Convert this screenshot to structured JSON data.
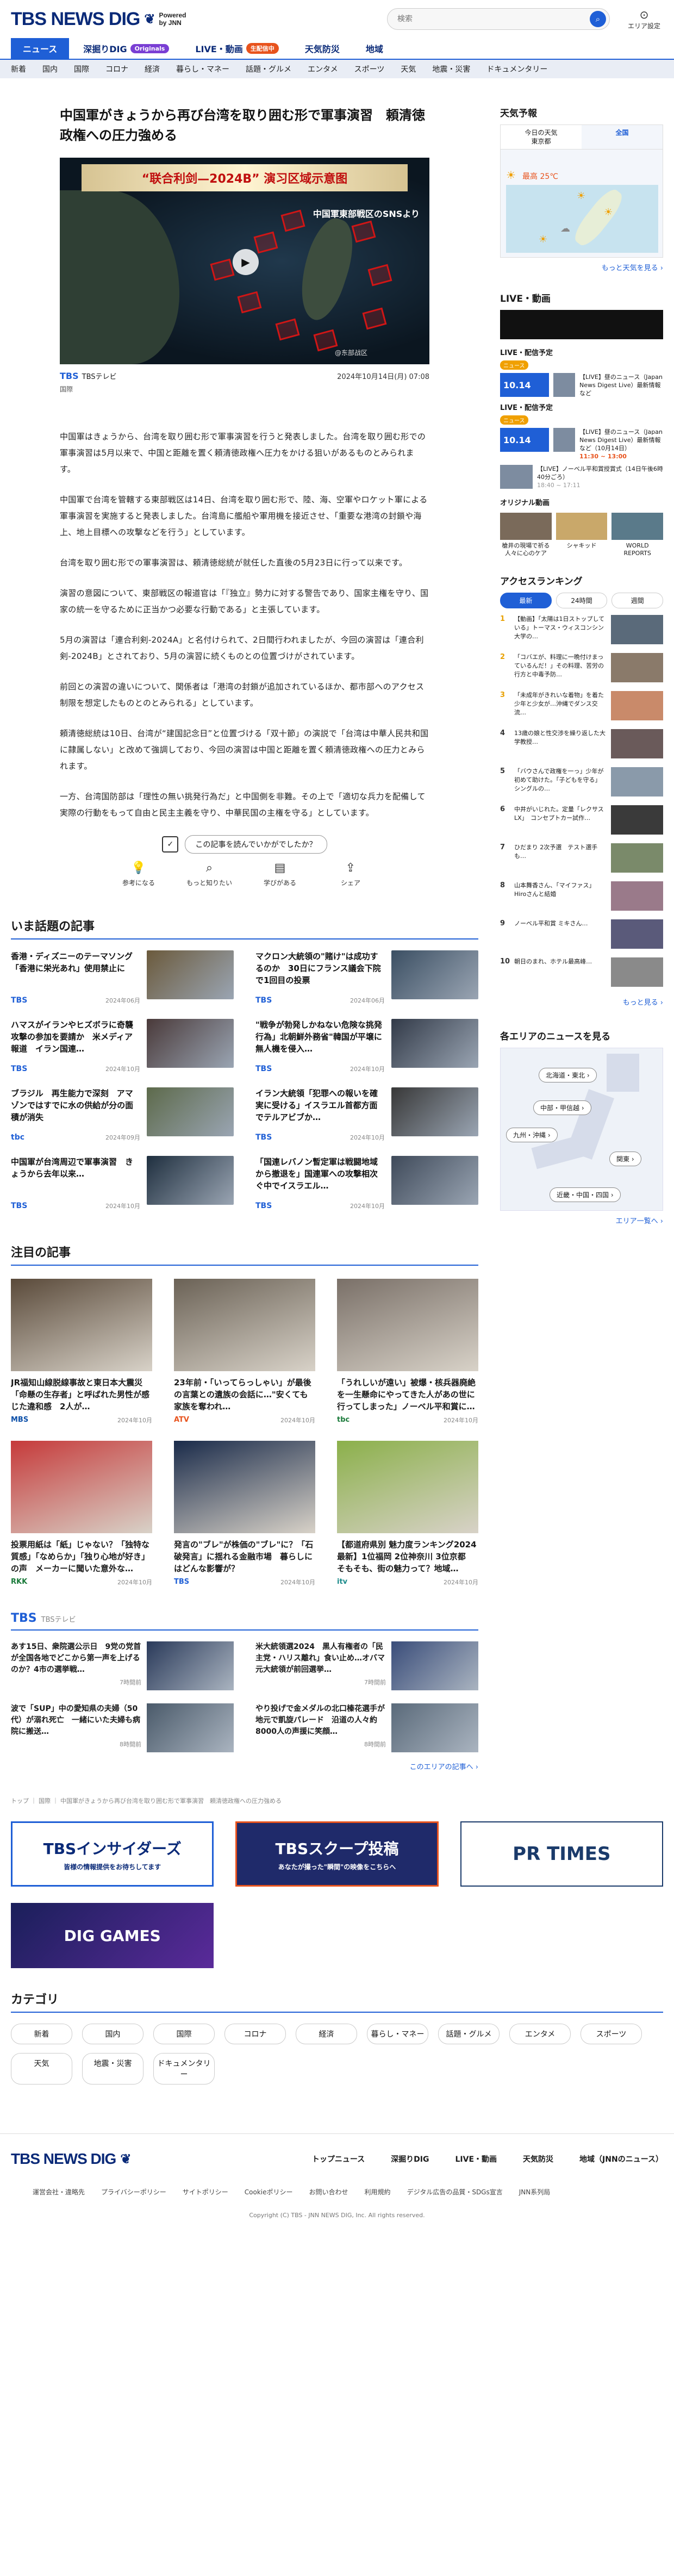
{
  "header": {
    "logo_text": "TBS NEWS DIG",
    "powered": "Powered",
    "powered_by": "by JNN",
    "search_placeholder": "検索",
    "area_label": "エリア設定"
  },
  "tabs": [
    {
      "label": "ニュース"
    },
    {
      "label": "深掘りDIG",
      "badge": "Originals"
    },
    {
      "label": "LIVE・動画",
      "badge": "生配信中"
    },
    {
      "label": "天気防災"
    },
    {
      "label": "地域"
    }
  ],
  "categories": [
    "新着",
    "国内",
    "国際",
    "コロナ",
    "経済",
    "暮らし・マネー",
    "話題・グルメ",
    "エンタメ",
    "スポーツ",
    "天気",
    "地震・災害",
    "ドキュメンタリー"
  ],
  "article": {
    "title": "中国軍がきょうから再び台湾を取り囲む形で軍事演習　頼清徳政権への圧力強める",
    "video_banner": "“联合利剑—2024B” 演习区域示意图",
    "video_tag": "中国軍東部戦区のSNSより",
    "video_watermark": "@东部战区",
    "source": "TBS",
    "source_name": "TBSテレビ",
    "date": "2024年10月14日(月) 07:08",
    "sub_source": "国際",
    "paragraphs": [
      "中国軍はきょうから、台湾を取り囲む形で軍事演習を行うと発表しました。台湾を取り囲む形での軍事演習は5月以来で、中国と距離を置く頼清徳政権へ圧力をかける狙いがあるものとみられます。",
      "中国軍で台湾を管轄する東部戦区は14日、台湾を取り囲む形で、陸、海、空軍やロケット軍による軍事演習を実施すると発表しました。台湾島に艦船や軍用機を接近させ、「重要な港湾の封鎖や海上、地上目標への攻撃などを行う」としています。",
      "台湾を取り囲む形での軍事演習は、頼清徳総統が就任した直後の5月23日に行って以来です。",
      "演習の意図について、東部戦区の報道官は「『独立』勢力に対する警告であり、国家主権を守り、国家の統一を守るために正当かつ必要な行動である」と主張しています。",
      "5月の演習は「連合利剣-2024A」と名付けられて、2日間行われましたが、今回の演習は「連合利剣-2024B」とされており、5月の演習に続くものとの位置づけがされています。",
      "前回との演習の違いについて、関係者は「港湾の封鎖が追加されているほか、都市部へのアクセス制限を想定したものとのとみられる」としています。",
      "頼清徳総統は10日、台湾が“建国記念日”と位置づける「双十節」の演説で「台湾は中華人民共和国に隷属しない」と改めて強調しており、今回の演習は中国と距離を置く頼清徳政権への圧力とみられます。",
      "一方、台湾国防部は「理性の無い挑発行為だ」と中国側を非難。その上で「適切な兵力を配備して実際の行動をもって自由と民主主義を守り、中華民国の主権を守る」としています。"
    ],
    "feedback_q": "この記事を読んでいかがでしたか？",
    "feedback_icons": [
      {
        "icon": "bulb-icon",
        "label": "参考になる"
      },
      {
        "icon": "magnify-icon",
        "label": "もっと知りたい"
      },
      {
        "icon": "book-icon",
        "label": "学びがある"
      },
      {
        "icon": "share-icon",
        "label": "シェア"
      }
    ]
  },
  "topics": {
    "title": "いま話題の記事",
    "items": [
      {
        "title": "香港・ディズニーのテーマソング「香港に栄光あれ」使用禁止に",
        "src": "TBS",
        "date": "2024年06月",
        "color": "#6b5a3c"
      },
      {
        "title": "マクロン大統領の\"賭け\"は成功するのか　30日にフランス議会下院で1回目の投票",
        "src": "TBS",
        "date": "2024年06月",
        "color": "#3b4f63"
      },
      {
        "title": "ハマスがイランやヒズボラに奇襲攻撃の参加を要請か　米メディア報道　イラン国連…",
        "src": "TBS",
        "date": "2024年10月",
        "color": "#4a3a3a"
      },
      {
        "title": "\"戦争が勃発しかねない危険な挑発行為」北朝鮮外務省\"韓国が平壌に無人機を侵入…",
        "src": "TBS",
        "date": "2024年10月",
        "color": "#323a48"
      },
      {
        "title": "ブラジル　再生能力で深刻　アマゾンではすでに水の供給が分の面積が消失",
        "src": "tbc",
        "date": "2024年09月",
        "color": "#5d6a4b"
      },
      {
        "title": "イラン大統領「犯罪への報いを確実に受ける」イスラエル首都方面でテルアビブか…",
        "src": "TBS",
        "date": "2024年10月",
        "color": "#383838"
      },
      {
        "title": "中国軍が台湾周辺で軍事演習　きょうから去年以来…",
        "src": "TBS",
        "date": "2024年10月",
        "color": "#1f2f3f"
      },
      {
        "title": "「国連レバノン暫定軍は戦闘地域から撤退を」国連軍への攻撃相次ぐ中でイスラエル…",
        "src": "TBS",
        "date": "2024年10月",
        "color": "#3f4a5a"
      }
    ]
  },
  "featured": {
    "title": "注目の記事",
    "items": [
      {
        "title": "JR福知山線脱線事故と東日本大震災「命懸の生存者」と呼ばれた男性が感じた違和感　2人が…",
        "src": "MBS",
        "date": "2024年10月",
        "color": "#5a4a3a"
      },
      {
        "title": "23年前・「いってらっしゃい」が最後の言葉との遺族の会話に…\"安くても家族を奪われ…",
        "src": "ATV",
        "date": "2024年10月",
        "color": "#6b6256"
      },
      {
        "title": "「うれしいが遠い」被爆・核兵器廃絶を一生懸命にやってきた人があの世に行ってしまった」ノーベル平和賞に…",
        "src": "tbc",
        "date": "2024年10月",
        "color": "#7a7068"
      },
      {
        "title": "投票用紙は「紙」じゃない？「独特な質感」「なめらか」「独り心地が好き」の声　メーカーに聞いた意外な…",
        "src": "RKK",
        "date": "2024年10月",
        "color": "#c63a3a"
      },
      {
        "title": "発言の\"ブレ\"が株価の\"ブレ\"に？「石破発言」に揺れる金融市場　暮らしにはどんな影響が？",
        "src": "TBS",
        "date": "2024年10月",
        "color": "#1a2b4a"
      },
      {
        "title": "【都道府県別 魅力度ランキング2024最新】1位福岡 2位神奈川 3位京都　そもそも、街の魅力って？地域…",
        "src": "itv",
        "date": "2024年10月",
        "color": "#8bb04a"
      }
    ]
  },
  "network": {
    "title": "TBS",
    "subtitle": "TBSテレビ",
    "items": [
      {
        "title": "あす15日、衆院選公示日　9党の党首が全国各地でどこから第一声を上げるのか？4市の選挙戦…",
        "date": "7時間前",
        "color": "#2a3a5a"
      },
      {
        "title": "米大統領選2024　黒人有権者の「民主党・ハリス離れ」食い止め…オバマ元大統領が前回選挙…",
        "date": "7時間前",
        "color": "#3a4d7a"
      },
      {
        "title": "波で「SUP」中の愛知県の夫婦（50代）が溺れ死亡　一緒にいた夫婦も病院に搬送…",
        "date": "8時間前",
        "color": "#4a5a6a"
      },
      {
        "title": "やり投げで金メダルの北口榛花選手が地元で凱旋パレード　沿道の人々約8000人の声援に笑顔…",
        "date": "8時間前",
        "color": "#5a6a7a"
      }
    ],
    "more": "このエリアの記事へ ›"
  },
  "breadcrumb": "トップ ｜ 国際 ｜ 中国軍がきょうから再び台湾を取り囲む形で軍事演習　頼清徳政権への圧力強める",
  "banners": [
    {
      "label": "TBSインサイダーズ",
      "sub": "皆様の情報提供をお待ちしてます"
    },
    {
      "label": "TBSスクープ投稿",
      "sub": "あなたが撮った\"瞬間\"の映像をこちらへ"
    },
    {
      "label": "PR TIMES"
    },
    {
      "label": "DIG GAMES"
    }
  ],
  "category_section": {
    "title": "カテゴリ",
    "items": [
      "新着",
      "国内",
      "国際",
      "コロナ",
      "経済",
      "暮らし・マネー",
      "話題・グルメ",
      "エンタメ",
      "スポーツ",
      "天気",
      "地震・災害",
      "ドキュメンタリー"
    ]
  },
  "footer": {
    "links": [
      "トップニュース",
      "深掘りDIG",
      "LIVE・動画",
      "天気防災",
      "地域（JNNのニュース）"
    ],
    "sublinks": [
      "運営会社・違略先",
      "プライバシーポリシー",
      "サイトポリシー",
      "Cookieポリシー",
      "お問い合わせ",
      "利用規約",
      "デジタル広告の品質・SDGs宣言",
      "JNN系列局"
    ],
    "copyright": "Copyright (C) TBS - JNN NEWS DIG, Inc. All rights reserved."
  },
  "sidebar": {
    "weather": {
      "title": "天気予報",
      "tab_today": "今日の天気",
      "tab_region": "東京都",
      "tab_map": "全国",
      "temp": "最高 25℃",
      "more": "もっと天気を見る ›"
    },
    "live": {
      "title": "LIVE・動画",
      "sched1": "LIVE・配信予定",
      "sched2": "LIVE・配信予定",
      "tag": "ニュース",
      "d1": "10.14",
      "t1": "【LIVE】昼のニュース（Japan News Digest Live）最新情報など",
      "d2": "10.14",
      "t2": "【LIVE】昼のニュース（Japan News Digest Live）最新情報など（10月14日）",
      "tm2": "11:30 ~ 13:00",
      "t3": "【LIVE】ノーベル平和賞授賞式（14日午後6時40分ごろ）",
      "tm3": "18:40 ~ 17:11"
    },
    "originals": {
      "title": "オリジナル動画",
      "items": [
        "槍井の現場で祈る人々に心のケア",
        "シャキッド",
        "WORLD REPORTS"
      ]
    },
    "ranking": {
      "title": "アクセスランキング",
      "tabs": [
        "最新",
        "24時間",
        "週間"
      ],
      "items": [
        "【動画】「太陽は1日ストップしている」トーマス・ウィスコンシン大学の…",
        "「コバエが、料理に一晩付けまっているんだ！」その料理、苦労の行方と中毒予防…",
        "「未成年がきれいな着物」を着た少年と少女が…沖縄でダンス交流…",
        "13歳の娘と性交渉を繰り返した大学教授…",
        "「バウさんで政権を一っ」少年が初めて助けた。「子どもを守る」シングルの…",
        "中井がいじれた。定量「レクサス LX」　コンセプトカー試作…",
        "ひだまり 2次予選　テスト選手も…",
        "山本舞香さん、「マイファス」 Hiroさんと結婚",
        "ノーベル平和賞 ミキさん…",
        "朝日のまれ、ホテル最高峰…"
      ]
    },
    "more": "もっと見る ›",
    "areas": {
      "title": "各エリアのニュースを見る",
      "pills": [
        "北海道・東北 ›",
        "中部・甲信越 ›",
        "九州・沖縄 ›",
        "関東 ›",
        "近畿・中国・四国 ›"
      ],
      "more": "エリア一覧へ ›"
    }
  }
}
